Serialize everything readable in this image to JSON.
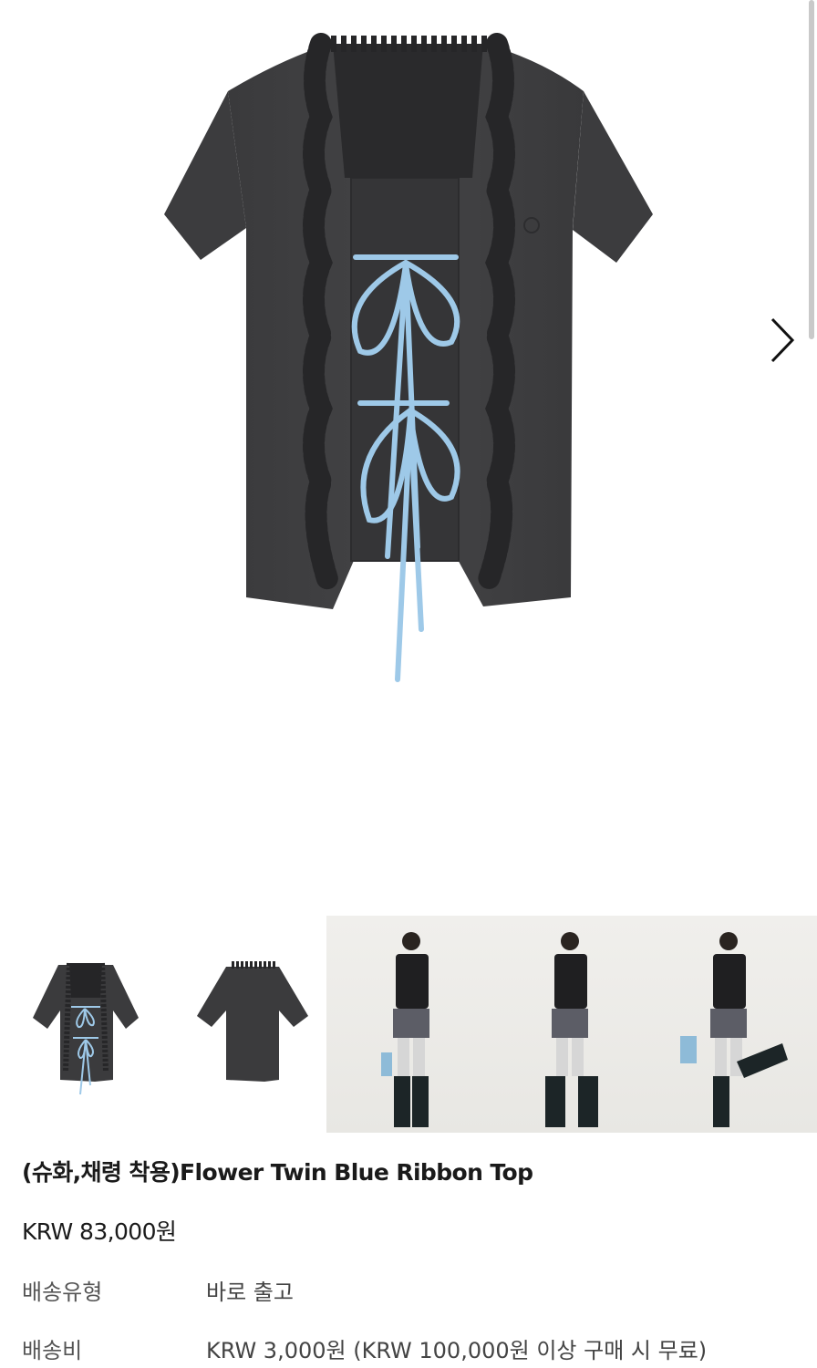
{
  "product": {
    "title": "(슈화,채령 착용)Flower Twin Blue Ribbon Top",
    "price": "KRW 83,000원",
    "info_rows": [
      {
        "label": "배송유형",
        "value": "바로 출고"
      },
      {
        "label": "배송비",
        "value": "KRW 3,000원 (KRW 100,000원 이상 구매 시 무료)"
      }
    ]
  },
  "gallery": {
    "main_image": "dark-grey-ruffle-top-blue-ribbons",
    "next_icon": "chevron-right-icon",
    "thumbnails": [
      "top-front",
      "top-back",
      "model-shots"
    ]
  },
  "colors": {
    "garment": "#3b3b3d",
    "ribbon": "#9ec9e8",
    "background": "#ffffff"
  }
}
